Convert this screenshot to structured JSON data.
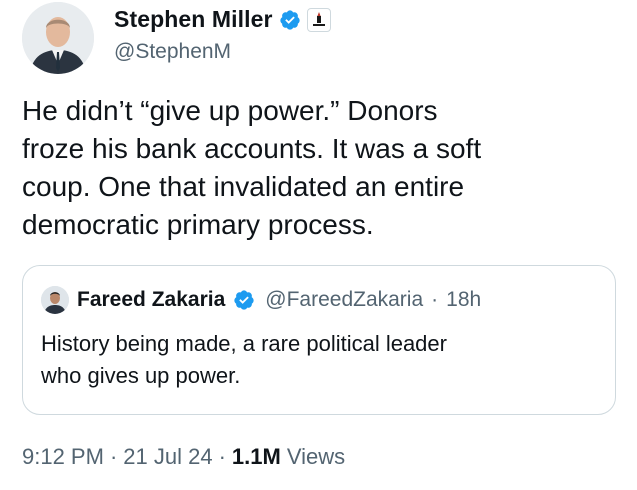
{
  "author": {
    "name": "Stephen Miller",
    "handle": "@StephenM",
    "verified_color": "#1d9bf0",
    "avatar_icon": "person-avatar",
    "affiliate_badge_icon": "flag-affiliate-badge"
  },
  "tweet": {
    "lines": [
      "He didn’t “give up power.” Donors",
      "froze his bank accounts. It was a soft",
      "coup. One that invalidated an entire",
      "democratic primary process."
    ]
  },
  "quoted": {
    "name": "Fareed Zakaria",
    "handle": "@FareedZakaria",
    "separator": "·",
    "time": "18h",
    "lines": [
      "History being made, a rare political leader",
      "who gives up power."
    ]
  },
  "meta": {
    "time": "9:12 PM",
    "sep1": "·",
    "date": "21 Jul 24",
    "sep2": "·",
    "views_count": "1.1M",
    "views_label": "Views"
  }
}
